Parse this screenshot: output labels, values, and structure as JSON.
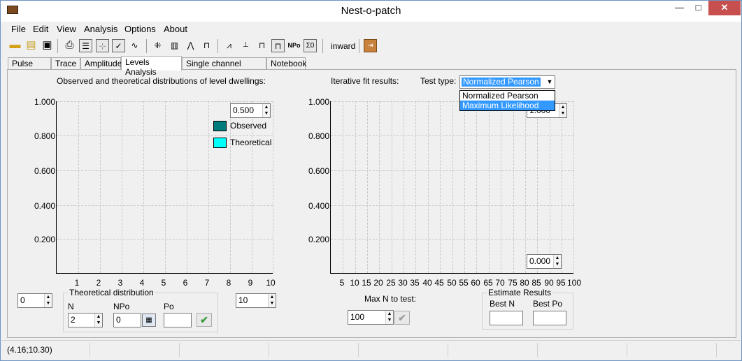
{
  "window": {
    "title": "Nest-o-patch",
    "min_label": "—",
    "max_label": "□",
    "close_label": "✕"
  },
  "menu": [
    "File",
    "Edit",
    "View",
    "Analysis",
    "Options",
    "About"
  ],
  "toolbar": {
    "direction_label": "inward"
  },
  "tabs": [
    "Pulse Tree",
    "Trace",
    "Amplitude",
    "Levels Analysis",
    "Single channel Kinetics",
    "Notebook"
  ],
  "left": {
    "heading": "Observed and theoretical distributions of level dwellings:",
    "y_ticks": [
      "1.000",
      "0.800",
      "0.600",
      "0.400",
      "0.200"
    ],
    "x_ticks": [
      "1",
      "2",
      "3",
      "4",
      "5",
      "6",
      "7",
      "8",
      "9",
      "10"
    ],
    "ymax_value": "0.500",
    "legend": [
      {
        "label": "Observed",
        "color": "#007b7b"
      },
      {
        "label": "Theoretical",
        "color": "#00ffff"
      }
    ],
    "min_value": "0",
    "max_value": "10",
    "theo": {
      "title": "Theoretical distribution",
      "n_label": "N",
      "npo_label": "NPo",
      "po_label": "Po",
      "n_value": "2",
      "npo_value": "0",
      "po_value": ""
    }
  },
  "right": {
    "heading": "Iterative fit results:",
    "test_type_label": "Test type:",
    "test_type_value": "Normalized Pearson",
    "options": [
      "Normalized Pearson",
      "Maximum Likelihood"
    ],
    "highlighted_option": "Maximum Likelihood",
    "y_ticks": [
      "1.000",
      "0.800",
      "0.600",
      "0.400",
      "0.200"
    ],
    "x_ticks": [
      "5",
      "10",
      "15",
      "20",
      "25",
      "30",
      "35",
      "40",
      "45",
      "50",
      "55",
      "60",
      "65",
      "70",
      "75",
      "80",
      "85",
      "90",
      "95",
      "100"
    ],
    "ymax_value": "1.000",
    "ymin_value": "0.000",
    "max_n_label": "Max N to test:",
    "max_n_value": "100",
    "estimate": {
      "title": "Estimate Results",
      "best_n_label": "Best N",
      "best_po_label": "Best Po"
    }
  },
  "status": {
    "coords": "(4.16;10.30)"
  }
}
